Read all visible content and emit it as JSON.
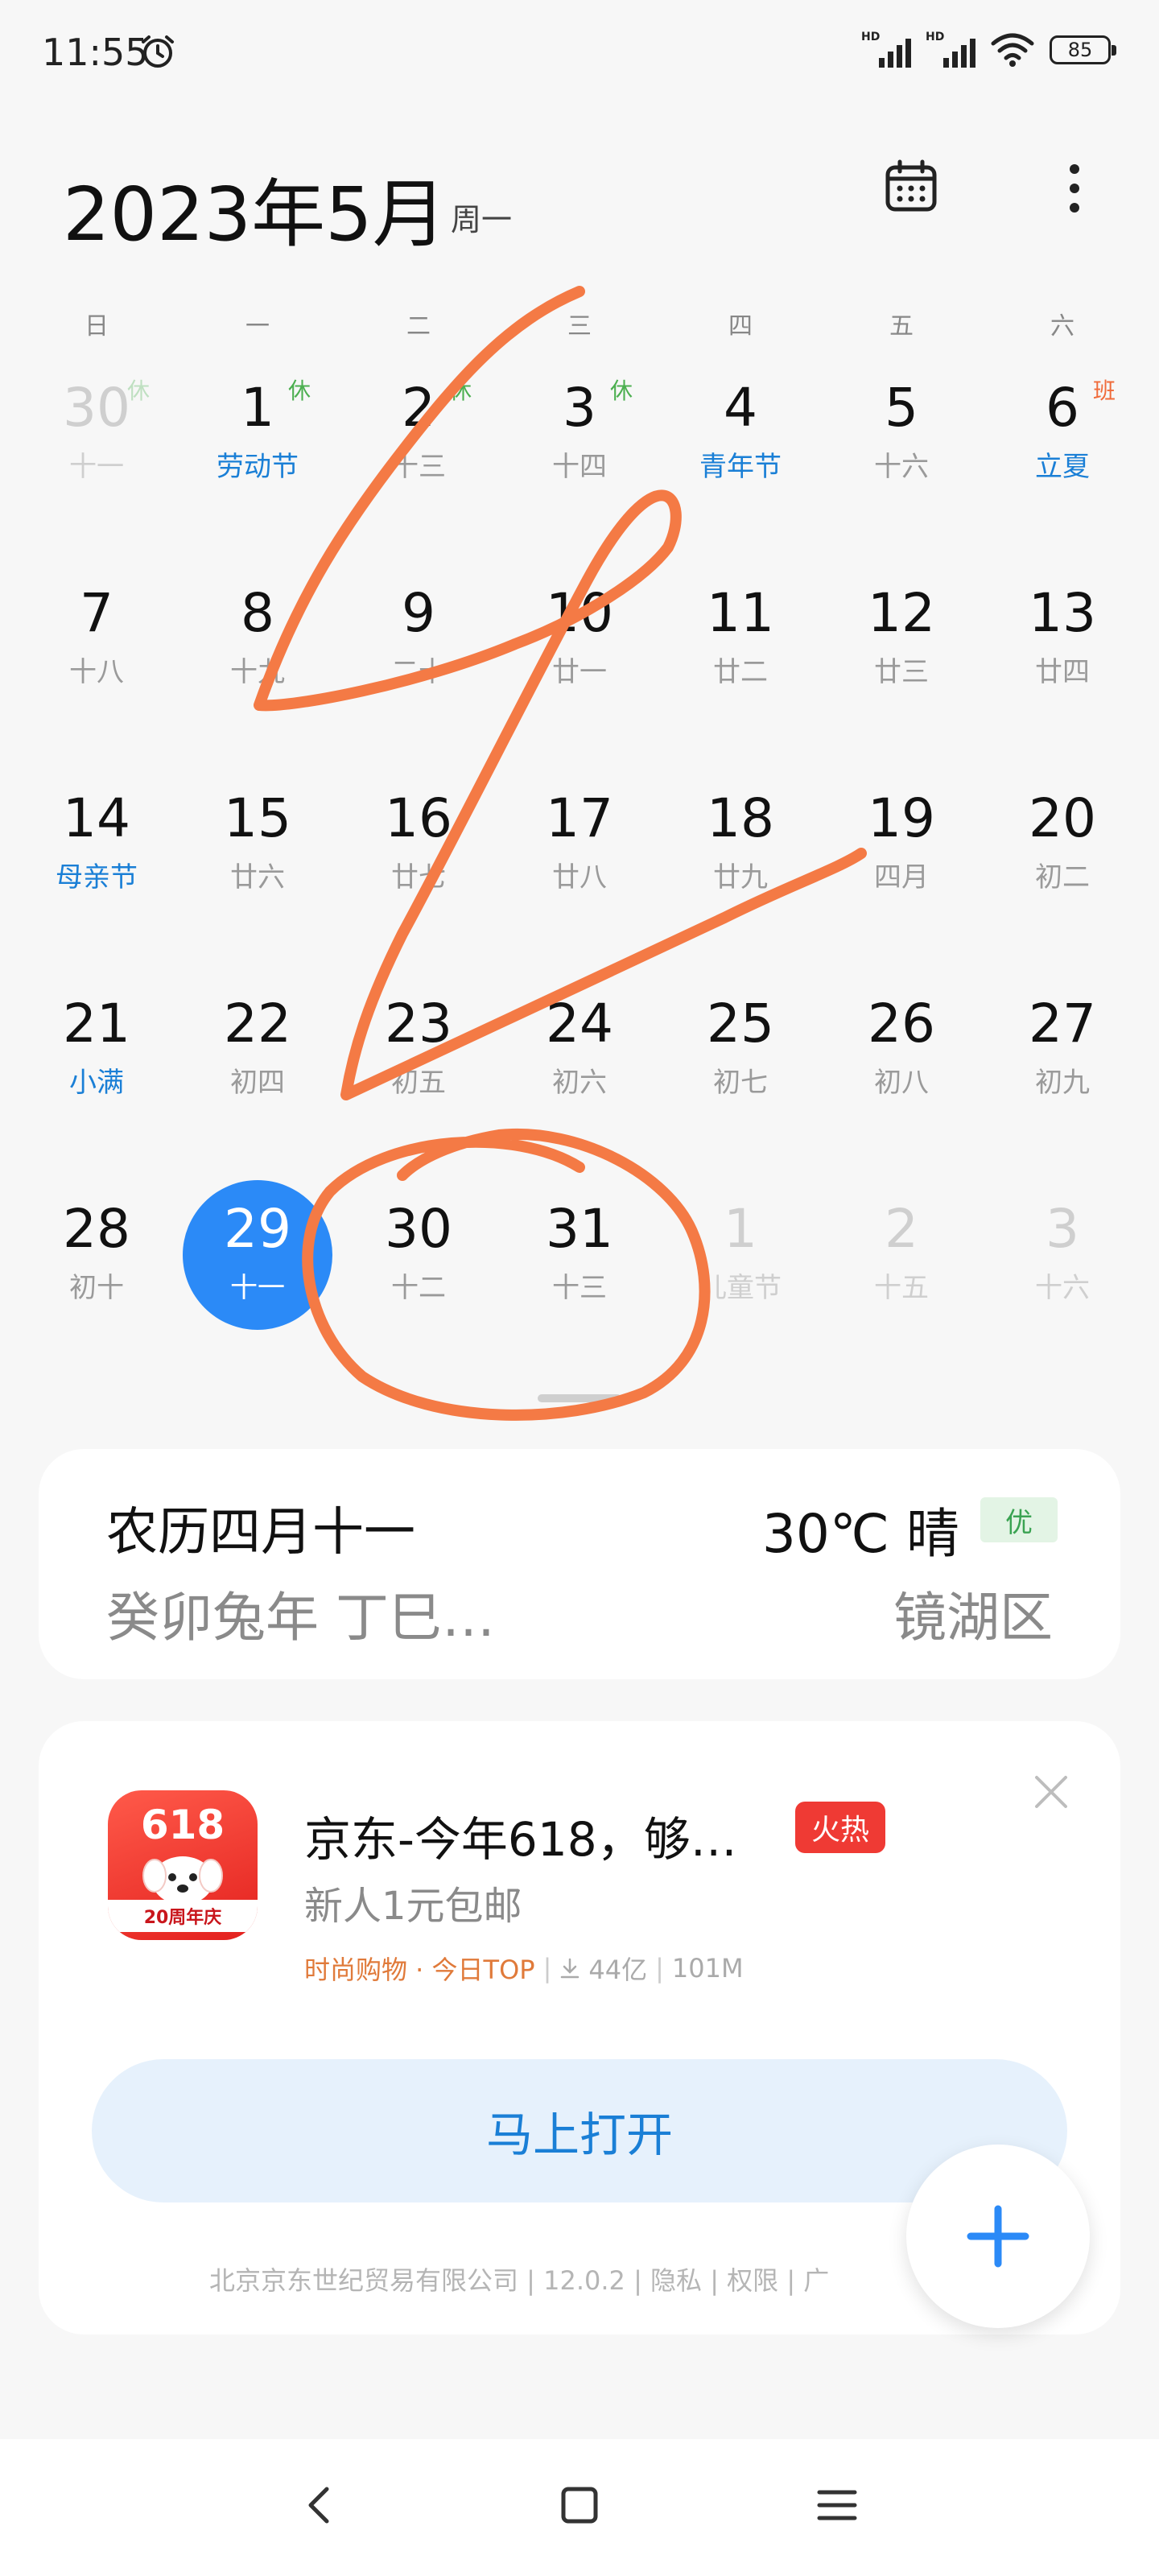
{
  "status_bar": {
    "time": "11:55",
    "network_label": "HD",
    "battery": "85",
    "icons": [
      "alarm-icon",
      "signal-icon",
      "wifi-icon",
      "battery-icon"
    ]
  },
  "header": {
    "title": "2023年5月",
    "weekday": "周一",
    "icons": [
      "calendar-icon",
      "more-icon"
    ]
  },
  "weekdays": [
    "日",
    "一",
    "二",
    "三",
    "四",
    "五",
    "六"
  ],
  "calendar": {
    "rows": [
      [
        {
          "day": "30",
          "lunar": "十一",
          "badge": "休",
          "dim": true
        },
        {
          "day": "1",
          "lunar": "劳动节",
          "badge": "休",
          "festival": true
        },
        {
          "day": "2",
          "lunar": "十三",
          "badge": "休"
        },
        {
          "day": "3",
          "lunar": "十四",
          "badge": "休"
        },
        {
          "day": "4",
          "lunar": "青年节",
          "festival": true
        },
        {
          "day": "5",
          "lunar": "十六"
        },
        {
          "day": "6",
          "lunar": "立夏",
          "badge": "班",
          "festival": true,
          "work": true
        }
      ],
      [
        {
          "day": "7",
          "lunar": "十八"
        },
        {
          "day": "8",
          "lunar": "十九"
        },
        {
          "day": "9",
          "lunar": "二十"
        },
        {
          "day": "10",
          "lunar": "廿一"
        },
        {
          "day": "11",
          "lunar": "廿二"
        },
        {
          "day": "12",
          "lunar": "廿三"
        },
        {
          "day": "13",
          "lunar": "廿四"
        }
      ],
      [
        {
          "day": "14",
          "lunar": "母亲节",
          "festival": true
        },
        {
          "day": "15",
          "lunar": "廿六"
        },
        {
          "day": "16",
          "lunar": "廿七"
        },
        {
          "day": "17",
          "lunar": "廿八"
        },
        {
          "day": "18",
          "lunar": "廿九"
        },
        {
          "day": "19",
          "lunar": "四月"
        },
        {
          "day": "20",
          "lunar": "初二"
        }
      ],
      [
        {
          "day": "21",
          "lunar": "小满",
          "festival": true
        },
        {
          "day": "22",
          "lunar": "初四"
        },
        {
          "day": "23",
          "lunar": "初五"
        },
        {
          "day": "24",
          "lunar": "初六"
        },
        {
          "day": "25",
          "lunar": "初七"
        },
        {
          "day": "26",
          "lunar": "初八"
        },
        {
          "day": "27",
          "lunar": "初九"
        }
      ],
      [
        {
          "day": "28",
          "lunar": "初十"
        },
        {
          "day": "29",
          "lunar": "十一",
          "selected": true
        },
        {
          "day": "30",
          "lunar": "十二"
        },
        {
          "day": "31",
          "lunar": "十三"
        },
        {
          "day": "1",
          "lunar": "儿童节",
          "dim": true
        },
        {
          "day": "2",
          "lunar": "十五",
          "dim": true
        },
        {
          "day": "3",
          "lunar": "十六",
          "dim": true
        }
      ]
    ]
  },
  "annotation_color": "#f47a45",
  "accent_color": "#2b8af7",
  "info_card": {
    "lunar_date": "农历四月十一",
    "ganzhi": "癸卯兔年 丁巳…",
    "weather": "30℃ 晴",
    "aqi": "优",
    "district": "镜湖区"
  },
  "ad_card": {
    "icon_number": "618",
    "icon_label": "20周年庆",
    "title": "京东-今年618，够…",
    "hot_badge": "火热",
    "subtitle": "新人1元包邮",
    "category": "时尚购物 · 今日TOP",
    "downloads": "44亿",
    "size": "101M",
    "open_button": "马上打开",
    "footer": "北京京东世纪贸易有限公司 | 12.0.2 | 隐私 | 权限 | 广"
  },
  "nav": {
    "icons": [
      "back-icon",
      "home-icon",
      "menu-icon"
    ]
  }
}
